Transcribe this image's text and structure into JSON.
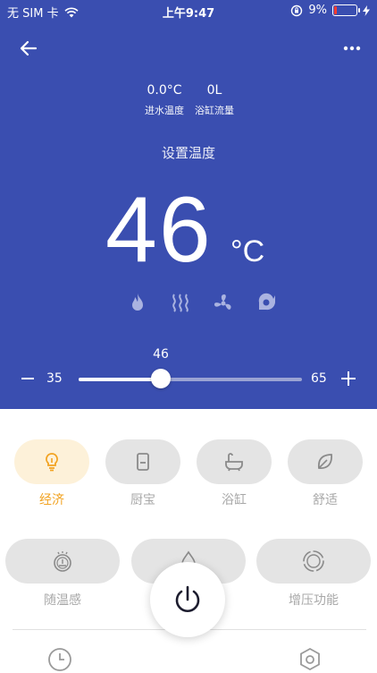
{
  "status_bar": {
    "carrier": "无 SIM 卡",
    "time": "上午9:47",
    "battery": "9%"
  },
  "stats": [
    {
      "value": "0.0°C",
      "label": "进水温度"
    },
    {
      "value": "0L",
      "label": "浴缸流量"
    }
  ],
  "set_temp_label": "设置温度",
  "temperature": {
    "value": "46",
    "unit": "°C"
  },
  "slider": {
    "value": "46",
    "min": "35",
    "max": "65",
    "current": 46
  },
  "modes": [
    {
      "label": "经济",
      "icon": "lightbulb-icon",
      "active": true
    },
    {
      "label": "厨宝",
      "icon": "water-heater-icon",
      "active": false
    },
    {
      "label": "浴缸",
      "icon": "bathtub-icon",
      "active": false
    },
    {
      "label": "舒适",
      "icon": "leaf-icon",
      "active": false
    }
  ],
  "functions": [
    {
      "label": "随温感",
      "icon": "thermo-sense-icon"
    },
    {
      "label": "",
      "icon": "water-drop-icon"
    },
    {
      "label": "增压功能",
      "icon": "boost-icon"
    }
  ],
  "colors": {
    "header_bg": "#3a4eb0",
    "active_mode": "#f2a322",
    "active_mode_bg": "#fdf1d9",
    "inactive_bg": "#e4e4e4"
  }
}
